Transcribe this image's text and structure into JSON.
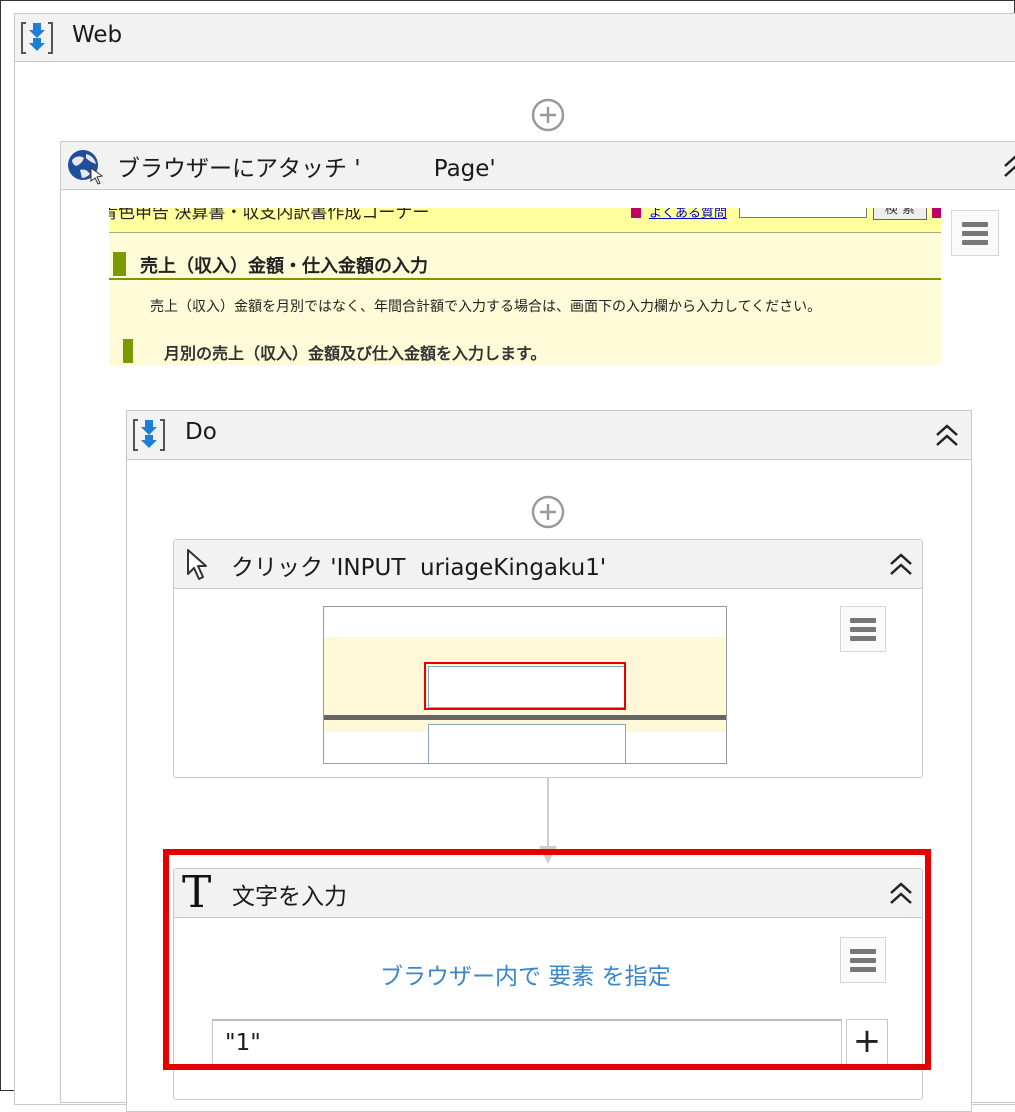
{
  "web_sequence": {
    "title": "Web"
  },
  "attach_browser": {
    "title": "ブラウザーにアタッチ '          Page'"
  },
  "page_preview": {
    "top_cut_text": "青色申告 決算書・収支内訳書作成コーナー",
    "faq_link": "よくある質問",
    "search_button": "検 索",
    "section_heading": "売上（収入）金額・仕入金額の入力",
    "description": "売上（収入）金額を月別ではなく、年間合計額で入力する場合は、画面下の入力欄から入力してください。",
    "sub_heading": "月別の売上（収入）金額及び仕入金額を入力します。"
  },
  "do_sequence": {
    "title": "Do"
  },
  "click_activity": {
    "title": "クリック 'INPUT  uriageKingaku1'"
  },
  "type_activity": {
    "title": "文字を入力",
    "indicate_link": "ブラウザー内で 要素 を指定",
    "text_value": "\"1\"",
    "plus_label": "+"
  },
  "colors": {
    "highlight": "#e60000",
    "accent": "#7a9a01",
    "link": "#3a86c8"
  }
}
